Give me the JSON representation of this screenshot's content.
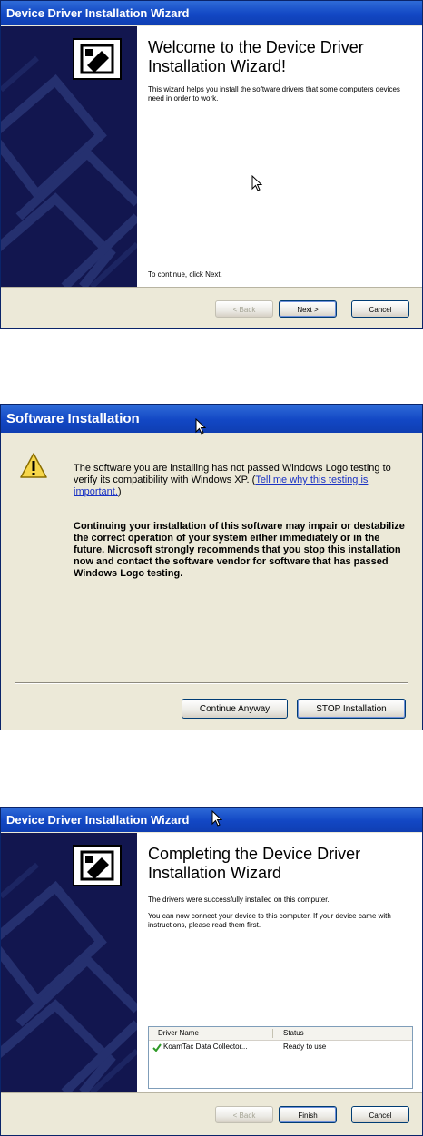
{
  "wizard1": {
    "title": "Device Driver Installation Wizard",
    "heading": "Welcome to the Device Driver Installation Wizard!",
    "body": "This wizard helps you install the software drivers that some computers devices need in order to work.",
    "continue_text": "To continue, click Next.",
    "back_label": "< Back",
    "next_label": "Next >",
    "cancel_label": "Cancel"
  },
  "warning": {
    "title": "Software Installation",
    "text": "The software you are installing has not passed Windows Logo testing to verify its compatibility with Windows XP. (",
    "link": "Tell me why this testing is important.",
    "text_after": ")",
    "bold_text": "Continuing your installation of this software may impair or destabilize the correct operation of your system either immediately or in the future. Microsoft strongly recommends that you stop this installation now and contact the software vendor for software that has passed Windows Logo testing.",
    "continue_label": "Continue Anyway",
    "stop_label": "STOP Installation"
  },
  "wizard2": {
    "title": "Device Driver Installation Wizard",
    "heading": "Completing the Device Driver Installation Wizard",
    "body1": "The drivers were successfully installed on this computer.",
    "body2": "You can now connect your device to this computer. If your device came with instructions, please read them first.",
    "columns": [
      "Driver Name",
      "Status"
    ],
    "rows": [
      {
        "name": "KoamTac Data Collector...",
        "status": "Ready to use"
      }
    ],
    "back_label": "< Back",
    "finish_label": "Finish",
    "cancel_label": "Cancel"
  },
  "colors": {
    "titlebar": "#1247c4",
    "sidebar": "#12164f",
    "dialog_bg": "#ece9d8",
    "check": "#2f9a27"
  }
}
